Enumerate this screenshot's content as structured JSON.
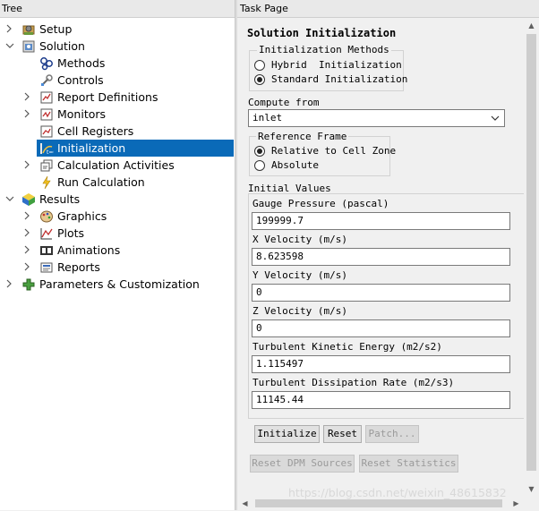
{
  "tree": {
    "header": "Tree",
    "items": [
      {
        "label": "Setup",
        "icon": "setup-icon",
        "expander": "collapsed"
      },
      {
        "label": "Solution",
        "icon": "solution-icon",
        "expander": "expanded"
      },
      {
        "label": "Methods",
        "icon": "methods-icon",
        "expander": "none"
      },
      {
        "label": "Controls",
        "icon": "controls-icon",
        "expander": "none"
      },
      {
        "label": "Report Definitions",
        "icon": "report-definitions-icon",
        "expander": "collapsed"
      },
      {
        "label": "Monitors",
        "icon": "monitors-icon",
        "expander": "collapsed"
      },
      {
        "label": "Cell Registers",
        "icon": "cell-registers-icon",
        "expander": "none"
      },
      {
        "label": "Initialization",
        "icon": "initialization-icon",
        "expander": "none",
        "selected": true
      },
      {
        "label": "Calculation Activities",
        "icon": "calculation-activities-icon",
        "expander": "collapsed"
      },
      {
        "label": "Run Calculation",
        "icon": "run-calculation-icon",
        "expander": "none"
      },
      {
        "label": "Results",
        "icon": "results-icon",
        "expander": "expanded"
      },
      {
        "label": "Graphics",
        "icon": "graphics-icon",
        "expander": "collapsed"
      },
      {
        "label": "Plots",
        "icon": "plots-icon",
        "expander": "collapsed"
      },
      {
        "label": "Animations",
        "icon": "animations-icon",
        "expander": "collapsed"
      },
      {
        "label": "Reports",
        "icon": "reports-icon",
        "expander": "collapsed"
      },
      {
        "label": "Parameters & Customization",
        "icon": "parameters-icon",
        "expander": "collapsed"
      }
    ],
    "selected_color": "#0a6ab8"
  },
  "task": {
    "header": "Task Page",
    "title": "Solution Initialization",
    "methods": {
      "label": "Initialization Methods",
      "options": [
        "Hybrid  Initialization",
        "Standard Initialization"
      ],
      "selected": "Standard Initialization"
    },
    "compute_from": {
      "label": "Compute from",
      "value": "inlet"
    },
    "reference_frame": {
      "label": "Reference Frame",
      "options": [
        "Relative to Cell Zone",
        "Absolute"
      ],
      "selected": "Relative to Cell Zone"
    },
    "initial_values": {
      "label": "Initial Values",
      "fields": [
        {
          "label": "Gauge Pressure (pascal)",
          "value": "199999.7"
        },
        {
          "label": "X Velocity (m/s)",
          "value": "8.623598"
        },
        {
          "label": "Y Velocity (m/s)",
          "value": "0"
        },
        {
          "label": "Z Velocity (m/s)",
          "value": "0"
        },
        {
          "label": "Turbulent Kinetic Energy (m2/s2)",
          "value": "1.115497"
        },
        {
          "label": "Turbulent Dissipation Rate (m2/s3)",
          "value": "11145.44"
        }
      ]
    },
    "buttons": {
      "initialize": "Initialize",
      "reset": "Reset",
      "patch": "Patch...",
      "reset_dpm": "Reset DPM Sources",
      "reset_stats": "Reset Statistics"
    }
  },
  "watermark": "https://blog.csdn.net/weixin_48615832"
}
